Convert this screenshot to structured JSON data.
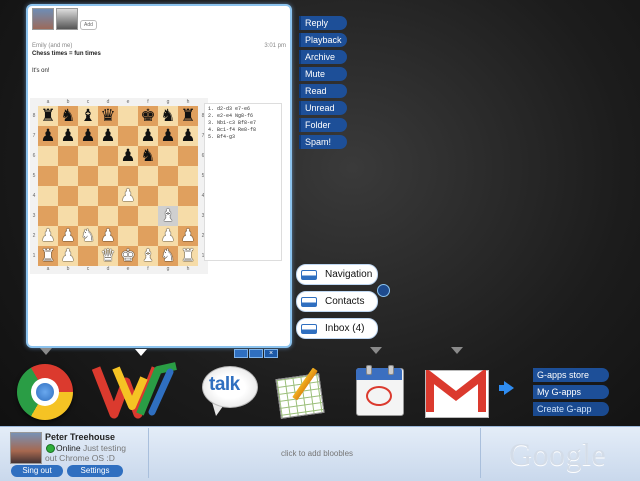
{
  "conversation": {
    "sender": "Emily (and me)",
    "time": "3:01 pm",
    "subject": "Chess times = fun times",
    "body": "It's on!",
    "add_label": "Add",
    "board": {
      "files": [
        "a",
        "b",
        "c",
        "d",
        "e",
        "f",
        "g",
        "h"
      ],
      "ranks": [
        "8",
        "7",
        "6",
        "5",
        "4",
        "3",
        "2",
        "1"
      ],
      "rows": [
        [
          "r",
          "n",
          "b",
          "q",
          "",
          "k",
          "n",
          "r"
        ],
        [
          "p",
          "p",
          "p",
          "p",
          "",
          "p",
          "p",
          "p"
        ],
        [
          "",
          "",
          "",
          "",
          "p",
          "n",
          "",
          ""
        ],
        [
          "",
          "",
          "",
          "",
          "",
          "",
          "",
          ""
        ],
        [
          "",
          "",
          "",
          "",
          "P",
          "",
          "",
          ""
        ],
        [
          "",
          "",
          "",
          "",
          "",
          "",
          "B",
          ""
        ],
        [
          "P",
          "P",
          "N",
          "P",
          "",
          "",
          "P",
          "P"
        ],
        [
          "R",
          "P",
          "",
          "Q",
          "K",
          "B",
          "N",
          "R"
        ]
      ],
      "highlight": [
        "g3"
      ]
    },
    "moves": [
      "1.  d2-d3 e7-e6",
      "2.  e2-e4 Ng8-f6",
      "3.  Nb1-c3 Bf8-e7",
      "4.  Bc1-f4 Re8-f8",
      "5.  Bf4-g3"
    ],
    "toolbar": [
      "minimize-icon",
      "maximize-icon",
      "close-icon"
    ]
  },
  "actions": [
    "Reply",
    "Playback",
    "Archive",
    "Mute",
    "Read",
    "Unread",
    "Folder",
    "Spam!"
  ],
  "pills": [
    {
      "label": "Navigation",
      "icon": "window-icon"
    },
    {
      "label": "Contacts",
      "icon": "window-icon"
    },
    {
      "label": "Inbox (4)",
      "icon": "window-icon"
    }
  ],
  "dock": {
    "apps": [
      "chrome",
      "wave",
      "talk",
      "spreadsheets",
      "calendar",
      "gmail"
    ],
    "talk_label": "talk",
    "gapps": [
      "G-apps store",
      "My G-apps",
      "Create G-app"
    ]
  },
  "user": {
    "name": "Peter Treehouse",
    "status": "Online",
    "status_message_1": "Just testing",
    "status_message_2": "out Chrome OS :D",
    "sign_out": "Sing out",
    "settings": "Settings"
  },
  "bloobles_hint": "click to add bloobles",
  "brand": "Google",
  "colors": {
    "accent": "#1d4f98",
    "window_border": "#8cc3ee",
    "board_light": "#f6dca8",
    "board_dark": "#e0a05e"
  }
}
